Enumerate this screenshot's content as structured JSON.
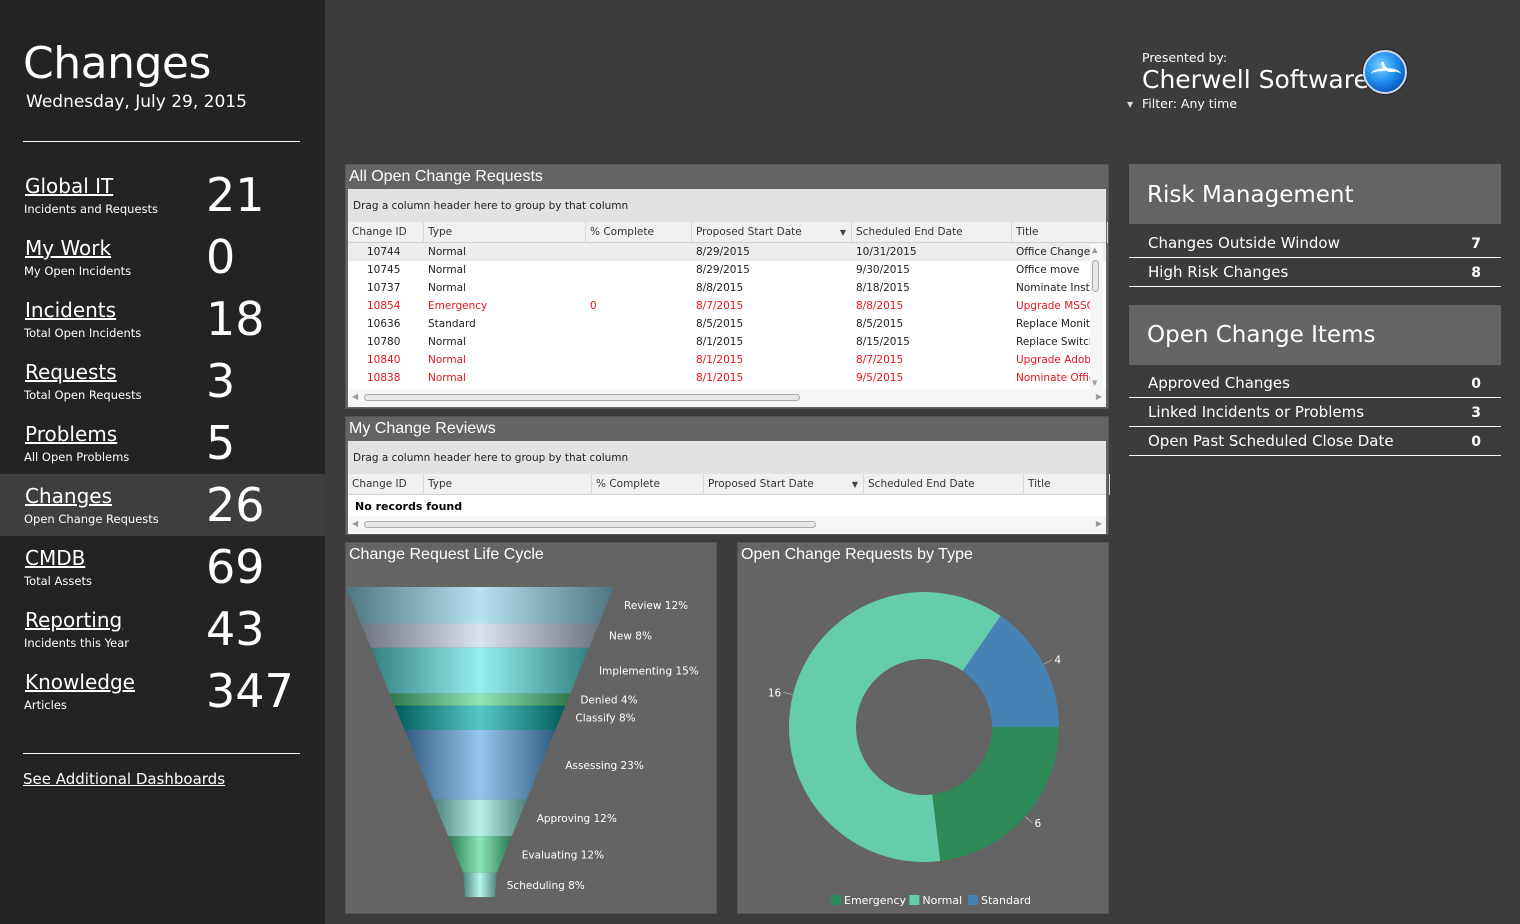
{
  "sidebar": {
    "title": "Changes",
    "date": "Wednesday, July 29, 2015",
    "items": [
      {
        "label": "Global IT",
        "sub": "Incidents and Requests",
        "count": "21",
        "active": false
      },
      {
        "label": "My Work",
        "sub": "My Open Incidents",
        "count": "0",
        "active": false
      },
      {
        "label": "Incidents",
        "sub": "Total Open Incidents",
        "count": "18",
        "active": false
      },
      {
        "label": "Requests",
        "sub": "Total Open Requests",
        "count": "3",
        "active": false
      },
      {
        "label": "Problems",
        "sub": "All Open Problems",
        "count": "5",
        "active": false
      },
      {
        "label": "Changes",
        "sub": "Open Change Requests",
        "count": "26",
        "active": true
      },
      {
        "label": "CMDB",
        "sub": "Total Assets",
        "count": "69",
        "active": false
      },
      {
        "label": "Reporting",
        "sub": "Incidents this Year",
        "count": "43",
        "active": false
      },
      {
        "label": "Knowledge",
        "sub": "Articles",
        "count": "347",
        "active": false
      }
    ],
    "more_link": "See Additional Dashboards"
  },
  "header": {
    "presented_by": "Presented by:",
    "company": "Cherwell Software",
    "filter": "Filter: Any time",
    "logo_icon": "cherwell-logo-icon"
  },
  "open_requests": {
    "title": "All Open Change Requests",
    "group_hint": "Drag a column header here to group by that column",
    "columns": [
      "Change ID",
      "Type",
      "% Complete",
      "Proposed Start Date",
      "Scheduled End Date",
      "Title"
    ],
    "sorted_column": "Proposed Start Date",
    "rows": [
      {
        "id": "10744",
        "type": "Normal",
        "pct": "",
        "start": "8/29/2015",
        "end": "10/31/2015",
        "title": "Office Change",
        "red": false,
        "selected": true
      },
      {
        "id": "10745",
        "type": "Normal",
        "pct": "",
        "start": "8/29/2015",
        "end": "9/30/2015",
        "title": "Office move",
        "red": false,
        "selected": false
      },
      {
        "id": "10737",
        "type": "Normal",
        "pct": "",
        "start": "8/8/2015",
        "end": "8/18/2015",
        "title": "Nominate Insta",
        "red": false,
        "selected": false
      },
      {
        "id": "10854",
        "type": "Emergency",
        "pct": "0",
        "start": "8/7/2015",
        "end": "8/8/2015",
        "title": "Upgrade MSSQ",
        "red": true,
        "selected": false
      },
      {
        "id": "10636",
        "type": "Standard",
        "pct": "",
        "start": "8/5/2015",
        "end": "8/5/2015",
        "title": "Replace Monito",
        "red": false,
        "selected": false
      },
      {
        "id": "10780",
        "type": "Normal",
        "pct": "",
        "start": "8/1/2015",
        "end": "8/15/2015",
        "title": "Replace Switch",
        "red": false,
        "selected": false
      },
      {
        "id": "10840",
        "type": "Normal",
        "pct": "",
        "start": "8/1/2015",
        "end": "8/7/2015",
        "title": "Upgrade Adob",
        "red": true,
        "selected": false
      },
      {
        "id": "10838",
        "type": "Normal",
        "pct": "",
        "start": "8/1/2015",
        "end": "9/5/2015",
        "title": "Nominate Offic",
        "red": true,
        "selected": false
      }
    ]
  },
  "reviews": {
    "title": "My Change Reviews",
    "group_hint": "Drag a column header here to group by that column",
    "columns": [
      "Change ID",
      "Type",
      "% Complete",
      "Proposed Start Date",
      "Scheduled End Date",
      "Title"
    ],
    "sorted_column": "Proposed Start Date",
    "empty": "No records found"
  },
  "risk": {
    "title": "Risk Management",
    "items": [
      {
        "label": "Changes Outside Window",
        "value": "7"
      },
      {
        "label": "High Risk Changes",
        "value": "8"
      }
    ]
  },
  "open_items": {
    "title": "Open Change Items",
    "items": [
      {
        "label": "Approved Changes",
        "value": "0"
      },
      {
        "label": "Linked Incidents or Problems",
        "value": "3"
      },
      {
        "label": "Open Past Scheduled Close Date",
        "value": "0"
      }
    ]
  },
  "chart_data": [
    {
      "type": "funnel",
      "title": "Change Request Life Cycle",
      "categories": [
        "Review",
        "New",
        "Implementing",
        "Denied",
        "Classify",
        "Assessing",
        "Approving",
        "Evaluating",
        "Scheduling"
      ],
      "values": [
        12,
        8,
        15,
        4,
        8,
        23,
        12,
        12,
        8
      ],
      "unit": "%",
      "colors": [
        "#8fd3ea",
        "#c8d2e6",
        "#5ee8e8",
        "#55d98a",
        "#00a8a8",
        "#5aa8e8",
        "#8eeadc",
        "#4ad88f",
        "#8ef0e0"
      ]
    },
    {
      "type": "pie",
      "donut": true,
      "title": "Open Change Requests by Type",
      "categories": [
        "Emergency",
        "Normal",
        "Standard"
      ],
      "values": [
        6,
        16,
        4
      ],
      "colors": [
        "#2e8b57",
        "#66cdaa",
        "#4682b4"
      ],
      "legend": "bottom"
    }
  ]
}
